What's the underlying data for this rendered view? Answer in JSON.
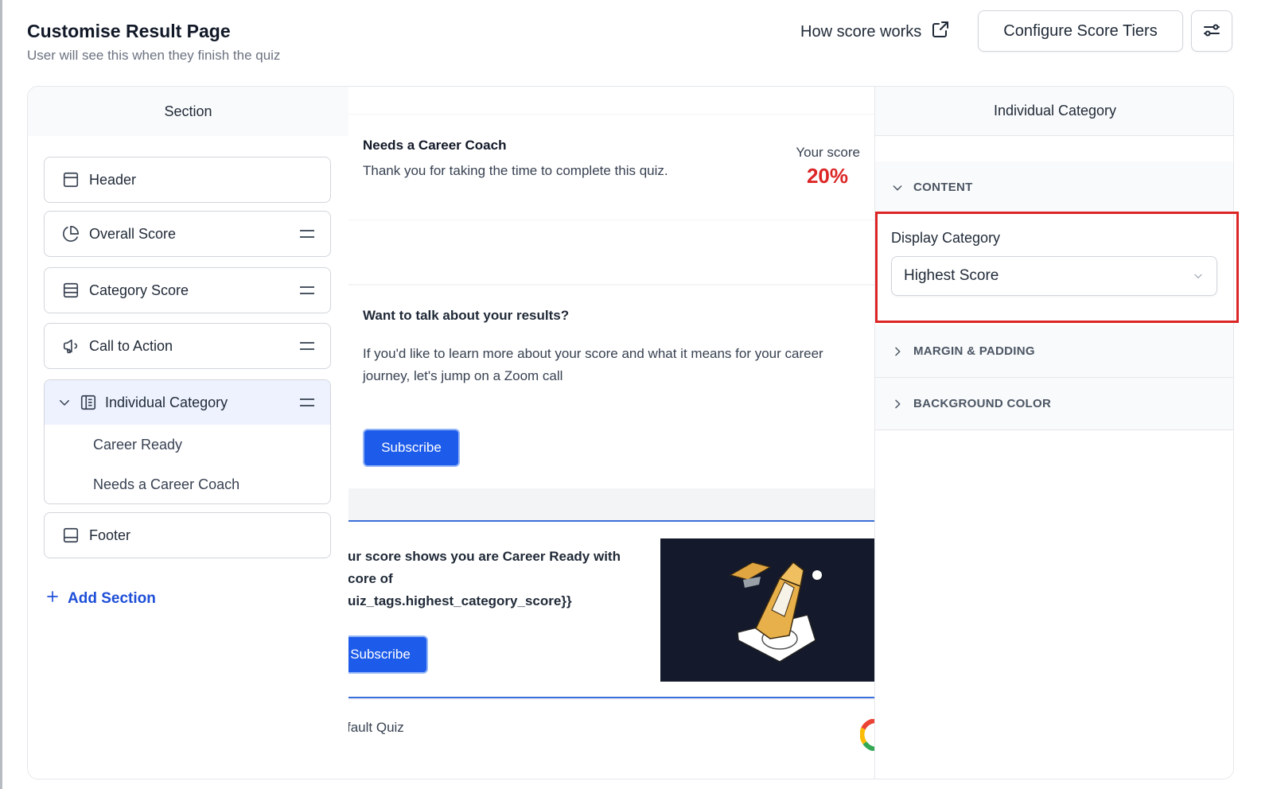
{
  "header": {
    "title": "Customise Result Page",
    "subtitle": "User will see this when they finish the quiz",
    "how_score_works": "How score works",
    "configure_button": "Configure Score Tiers"
  },
  "sections_panel": {
    "title": "Section",
    "items": [
      {
        "label": "Header",
        "icon": "header-layout-icon"
      },
      {
        "label": "Overall Score",
        "icon": "pie-chart-icon"
      },
      {
        "label": "Category Score",
        "icon": "rows-icon"
      },
      {
        "label": "Call to Action",
        "icon": "megaphone-icon"
      }
    ],
    "group": {
      "label": "Individual Category",
      "icon": "list-document-icon",
      "children": [
        "Career Ready",
        "Needs a Career Coach"
      ]
    },
    "footer": {
      "label": "Footer",
      "icon": "footer-layout-icon"
    },
    "add_section": "Add Section"
  },
  "preview": {
    "score_card": {
      "title": "Needs a Career Coach",
      "text": "Thank you for taking the time to complete this quiz.",
      "score_label": "Your score",
      "score_value": "20%"
    },
    "cta_card": {
      "title": "Want to talk about your results?",
      "text": "If you'd like to learn more about your score and what it means for your career journey, let's jump on a Zoom call",
      "button": "Subscribe"
    },
    "category_card": {
      "line1": "ur score shows you are Career Ready with",
      "line2": "core of",
      "line3": "uiz_tags.highest_category_score}}",
      "button": "Subscribe"
    },
    "footer_card": {
      "text": "fault Quiz"
    }
  },
  "settings_panel": {
    "title": "Individual Category",
    "content_label": "CONTENT",
    "display_category_label": "Display Category",
    "display_category_value": "Highest Score",
    "margin_padding_label": "MARGIN & PADDING",
    "background_color_label": "BACKGROUND COLOR"
  },
  "colors": {
    "accent": "#1d5bea",
    "score": "#dc2626",
    "highlight": "#dc2626"
  }
}
